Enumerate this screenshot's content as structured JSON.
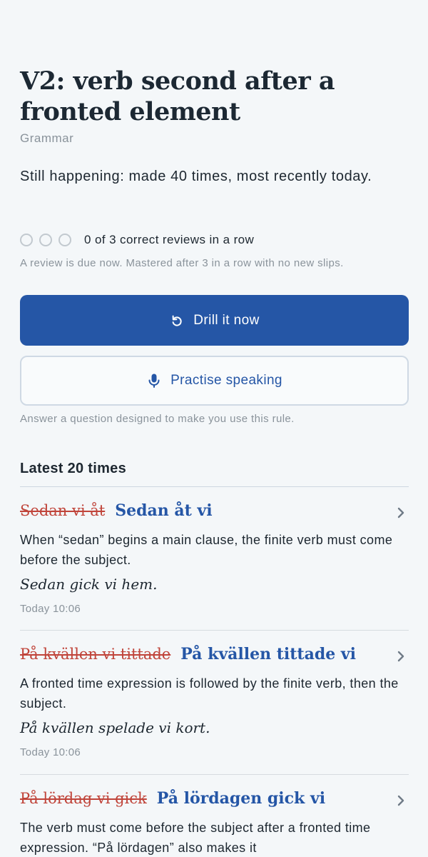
{
  "rule": {
    "title": "V2: verb second after a fronted element",
    "category": "Grammar",
    "status": "Still happening: made 40 times, most recently today.",
    "progress_text": "0 of 3 correct reviews in a row",
    "progress": {
      "correct": 0,
      "target": 3
    },
    "hint": "A review is due now. Mastered after 3 in a row with no new slips."
  },
  "actions": {
    "drill_label": "Drill it now",
    "drill_icon": "refresh-icon",
    "speak_label": "Practise speaking",
    "speak_icon": "microphone-icon",
    "answer_hint": "Answer a question designed to make you use this rule."
  },
  "history": {
    "title": "Latest 20 times",
    "entries": [
      {
        "wrong": "Sedan vi åt",
        "right": "Sedan åt vi",
        "explanation": "When “sedan” begins a main clause, the finite verb must come before the subject.",
        "example": "Sedan gick vi hem.",
        "time": "Today 10:06"
      },
      {
        "wrong": "På kvällen vi tittade",
        "right": "På kvällen tittade vi",
        "explanation": "A fronted time expression is followed by the finite verb, then the subject.",
        "example": "På kvällen spelade vi kort.",
        "time": "Today 10:06"
      },
      {
        "wrong": "På lördag vi gick",
        "right": "På lördagen gick vi",
        "explanation": "The verb must come before the subject after a fronted time expression. “På lördagen” also makes it",
        "example": "",
        "time": ""
      }
    ]
  },
  "colors": {
    "background": "#f4f7f9",
    "accent": "#2556a6",
    "error": "#c0443a",
    "muted": "#8a939b"
  }
}
